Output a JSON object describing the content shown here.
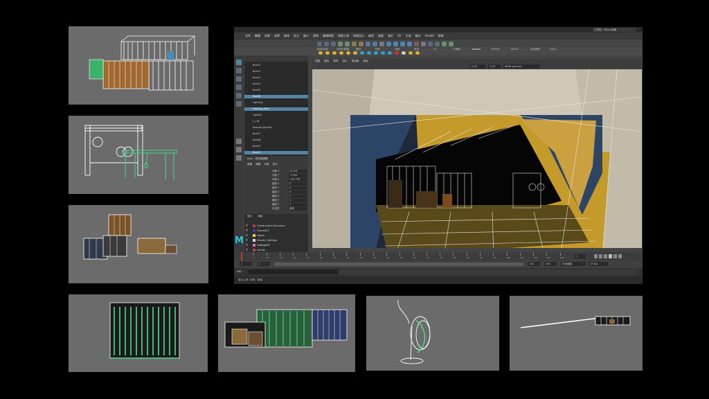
{
  "app": {
    "name": "Autodesk Maya",
    "logo_letter": "M",
    "menus": [
      "文件",
      "编辑",
      "创建",
      "选择",
      "修改",
      "显示",
      "窗口",
      "网格",
      "编辑网格",
      "网格工具",
      "网格显示",
      "曲线",
      "曲面",
      "变形",
      "UV",
      "生成",
      "缓存",
      "Arnold",
      "帮助"
    ],
    "shelf_tabs": [
      "曲线/曲面",
      "多边形建模",
      "雕刻",
      "绑定",
      "动画",
      "渲染",
      "FX",
      "FX缓存",
      "Arnold",
      "Bifrost",
      "MASH",
      "运动图形",
      "XGen"
    ],
    "workspace": "工作区：Maya 经典"
  },
  "outliner": {
    "items": [
      {
        "label": "Box01",
        "selected": false
      },
      {
        "label": "Box02",
        "selected": false
      },
      {
        "label": "Box03",
        "selected": false
      },
      {
        "label": "Box04",
        "selected": false
      },
      {
        "label": "Box05",
        "selected": false
      },
      {
        "label": "Box06",
        "selected": true
      },
      {
        "label": "Lighting",
        "selected": false
      },
      {
        "label": "Floating_Tent",
        "selected": true
      },
      {
        "label": "Light01",
        "selected": false
      },
      {
        "label": "L_Lift",
        "selected": false
      },
      {
        "label": "defaultLightSet",
        "selected": false
      },
      {
        "label": "Box07",
        "selected": false
      },
      {
        "label": "Box08",
        "selected": false
      },
      {
        "label": "Box09",
        "selected": false
      },
      {
        "label": "Box10",
        "selected": true
      }
    ]
  },
  "attribute_editor": {
    "title": "poly... 属性编辑器",
    "tabs": [
      "通道",
      "编辑",
      "对象",
      "显示"
    ],
    "rows": [
      {
        "label": "平移 X",
        "value": "22.901"
      },
      {
        "label": "平移 Y",
        "value": "-1.936"
      },
      {
        "label": "平移 Z",
        "value": "-129.776"
      },
      {
        "label": "旋转 X",
        "value": "0"
      },
      {
        "label": "旋转 Y",
        "value": "0"
      },
      {
        "label": "旋转 Z",
        "value": "0"
      },
      {
        "label": "缩放 X",
        "value": "1"
      },
      {
        "label": "缩放 Y",
        "value": "1"
      },
      {
        "label": "缩放 Z",
        "value": "1"
      },
      {
        "label": "可见性",
        "value": "启用"
      }
    ]
  },
  "layers": {
    "tabs": [
      "显示",
      "动画"
    ],
    "items": [
      {
        "label": "Construction Structure",
        "color": "#c23b3b"
      },
      {
        "label": "Ground01",
        "color": "#3a3ac2"
      },
      {
        "label": "Lights",
        "color": "#e8d23a"
      },
      {
        "label": "Shader_Settings",
        "color": "#d8d8d8"
      },
      {
        "label": "rotBagRoll",
        "color": "#d96bb6"
      },
      {
        "label": "Lamps",
        "color": "#c23b3b"
      }
    ]
  },
  "viewport": {
    "menu": [
      "视图",
      "着色",
      "照明",
      "显示",
      "渲染器",
      "面板"
    ],
    "camera_label": "persp",
    "frame_field": "0.00",
    "scale_field": "1.00",
    "color_space": "sRGB gamma"
  },
  "timeline": {
    "ticks": [
      "5",
      "10",
      "15",
      "20",
      "25",
      "30",
      "35",
      "40",
      "45",
      "50",
      "55",
      "60",
      "65",
      "70",
      "75",
      "80",
      "85",
      "90",
      "95",
      "100",
      "105",
      "110",
      "115",
      "120"
    ],
    "current_frame": "1",
    "start": "1",
    "start2": "1",
    "end": "120",
    "end2": "200",
    "anim_layer": "无动画层",
    "fps": "24 fps"
  },
  "command_line": {
    "label": "MEL"
  },
  "help_line": {
    "text": "显示工具: 平移、旋转..."
  }
}
